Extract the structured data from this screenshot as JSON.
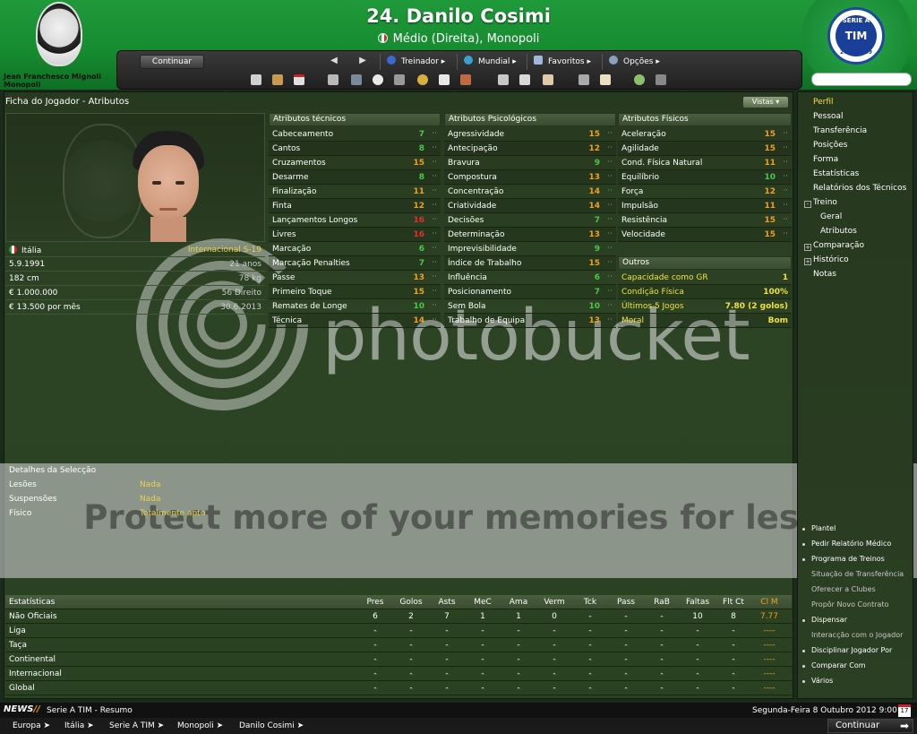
{
  "header": {
    "manager_name": "Jean Franchesco Mignoli",
    "manager_club": "Monopoli",
    "player_title": "24. Danilo Cosimi",
    "player_subtitle": "Médio (Direita), Monopoli",
    "league_badge_top": "SERIE A",
    "league_badge_main": "TIM",
    "league_badge_season": "2008-2009"
  },
  "toolbar": {
    "continue_label": "Continuar",
    "back_arrow": "◀",
    "forward_arrow": "▶",
    "menus": [
      "Treinador ▸",
      "Mundial ▸",
      "Favoritos ▸",
      "Opções ▸"
    ]
  },
  "panel": {
    "title": "Ficha do Jogador - Atributos",
    "views_label": "Vistas ▾"
  },
  "player_info": [
    {
      "label": "Itália",
      "value": "Internacional S-19",
      "flag": true
    },
    {
      "label": "5.9.1991",
      "value": "21 anos"
    },
    {
      "label": "182 cm",
      "value": "78 kg"
    },
    {
      "label": "€ 1.000.000",
      "value": "56 Direito"
    },
    {
      "label": "€ 13.500 por mês",
      "value": "30.6.2013"
    }
  ],
  "technical": {
    "title": "Atributos técnicos",
    "rows": [
      {
        "name": "Cabeceamento",
        "value": "7",
        "color": "#4ac84a"
      },
      {
        "name": "Cantos",
        "value": "8",
        "color": "#4ac84a"
      },
      {
        "name": "Cruzamentos",
        "value": "15",
        "color": "#f0a020"
      },
      {
        "name": "Desarme",
        "value": "8",
        "color": "#4ac84a"
      },
      {
        "name": "Finalização",
        "value": "11",
        "color": "#f0a020"
      },
      {
        "name": "Finta",
        "value": "12",
        "color": "#f0a020"
      },
      {
        "name": "Lançamentos Longos",
        "value": "16",
        "color": "#e03030"
      },
      {
        "name": "Livres",
        "value": "16",
        "color": "#e03030"
      },
      {
        "name": "Marcação",
        "value": "6",
        "color": "#4ac84a"
      },
      {
        "name": "Marcação Penalties",
        "value": "7",
        "color": "#4ac84a"
      },
      {
        "name": "Passe",
        "value": "13",
        "color": "#f0a020"
      },
      {
        "name": "Primeiro Toque",
        "value": "15",
        "color": "#f0a020"
      },
      {
        "name": "Remates de Longe",
        "value": "10",
        "color": "#4ac84a"
      },
      {
        "name": "Técnica",
        "value": "14",
        "color": "#f0a020"
      }
    ]
  },
  "mental": {
    "title": "Atributos Psicológicos",
    "rows": [
      {
        "name": "Agressividade",
        "value": "15",
        "color": "#f0a020"
      },
      {
        "name": "Antecipação",
        "value": "12",
        "color": "#f0a020"
      },
      {
        "name": "Bravura",
        "value": "9",
        "color": "#4ac84a"
      },
      {
        "name": "Compostura",
        "value": "13",
        "color": "#f0a020"
      },
      {
        "name": "Concentração",
        "value": "14",
        "color": "#f0a020"
      },
      {
        "name": "Criatividade",
        "value": "14",
        "color": "#f0a020"
      },
      {
        "name": "Decisões",
        "value": "7",
        "color": "#4ac84a"
      },
      {
        "name": "Determinação",
        "value": "13",
        "color": "#f0a020"
      },
      {
        "name": "Imprevisibilidade",
        "value": "9",
        "color": "#4ac84a"
      },
      {
        "name": "Índice de Trabalho",
        "value": "15",
        "color": "#f0a020"
      },
      {
        "name": "Influência",
        "value": "6",
        "color": "#4ac84a"
      },
      {
        "name": "Posicionamento",
        "value": "7",
        "color": "#4ac84a"
      },
      {
        "name": "Sem Bola",
        "value": "10",
        "color": "#4ac84a"
      },
      {
        "name": "Trabalho de Equipa",
        "value": "13",
        "color": "#f0a020"
      }
    ]
  },
  "physical": {
    "title": "Atributos Físicos",
    "rows": [
      {
        "name": "Aceleração",
        "value": "15",
        "color": "#f0a020"
      },
      {
        "name": "Agilidade",
        "value": "15",
        "color": "#f0a020"
      },
      {
        "name": "Cond. Física Natural",
        "value": "11",
        "color": "#f0a020"
      },
      {
        "name": "Equilíbrio",
        "value": "10",
        "color": "#4ac84a"
      },
      {
        "name": "Força",
        "value": "12",
        "color": "#f0a020"
      },
      {
        "name": "Impulsão",
        "value": "11",
        "color": "#f0a020"
      },
      {
        "name": "Resistência",
        "value": "15",
        "color": "#f0a020"
      },
      {
        "name": "Velocidade",
        "value": "15",
        "color": "#f0a020"
      }
    ]
  },
  "outros": {
    "title": "Outros",
    "rows": [
      {
        "name": "Capacidade como GR",
        "value": "1"
      },
      {
        "name": "Condição Física",
        "value": "100%"
      },
      {
        "name": "Últimos 5 Jogos",
        "value": "7.80 (2 golos)"
      },
      {
        "name": "Moral",
        "value": "Bom"
      }
    ]
  },
  "watermark": {
    "text": "photobucket",
    "promo": "Protect more of your memories for less!"
  },
  "selection": {
    "title": "Detalhes da Selecção",
    "rows": [
      {
        "label": "Lesões",
        "value": "Nada"
      },
      {
        "label": "Suspensões",
        "value": "Nada"
      },
      {
        "label": "Físico",
        "value": "Totalmente apto"
      }
    ]
  },
  "stats": {
    "title": "Estatísticas",
    "columns": [
      "Pres",
      "Golos",
      "Asts",
      "MeC",
      "Ama",
      "Verm",
      "Tck",
      "Pass",
      "RaB",
      "Faltas",
      "Flt Ct",
      "Cl M"
    ],
    "rows": [
      {
        "label": "Não Oficiais",
        "cells": [
          "6",
          "2",
          "7",
          "1",
          "1",
          "0",
          "-",
          "-",
          "-",
          "10",
          "8",
          "7.77"
        ]
      },
      {
        "label": "Liga",
        "cells": [
          "-",
          "-",
          "-",
          "-",
          "-",
          "-",
          "-",
          "-",
          "-",
          "-",
          "-",
          "----"
        ]
      },
      {
        "label": "Taça",
        "cells": [
          "-",
          "-",
          "-",
          "-",
          "-",
          "-",
          "-",
          "-",
          "-",
          "-",
          "-",
          "----"
        ]
      },
      {
        "label": "Continental",
        "cells": [
          "-",
          "-",
          "-",
          "-",
          "-",
          "-",
          "-",
          "-",
          "-",
          "-",
          "-",
          "----"
        ]
      },
      {
        "label": "Internacional",
        "cells": [
          "-",
          "-",
          "-",
          "-",
          "-",
          "-",
          "-",
          "-",
          "-",
          "-",
          "-",
          "----"
        ]
      },
      {
        "label": "Global",
        "cells": [
          "-",
          "-",
          "-",
          "-",
          "-",
          "-",
          "-",
          "-",
          "-",
          "-",
          "-",
          "----"
        ]
      }
    ]
  },
  "sidebar": {
    "items": [
      {
        "label": "Perfil",
        "active": true
      },
      {
        "label": "Pessoal"
      },
      {
        "label": "Transferência"
      },
      {
        "label": "Posições"
      },
      {
        "label": "Forma"
      },
      {
        "label": "Estatísticas"
      },
      {
        "label": "Relatórios dos Técnicos"
      },
      {
        "label": "Treino",
        "toggle": "-"
      },
      {
        "label": "Geral",
        "sub": true
      },
      {
        "label": "Atributos",
        "sub": true
      },
      {
        "label": "Comparação",
        "toggle": "+"
      },
      {
        "label": "Histórico",
        "toggle": "+"
      },
      {
        "label": "Notas"
      }
    ],
    "actions": [
      {
        "label": "Plantel",
        "bullet": true
      },
      {
        "label": "Pedir Relatório Médico",
        "bullet": true
      },
      {
        "label": "Programa de Treinos",
        "bullet": true
      },
      {
        "label": "Situação de Transferência"
      },
      {
        "label": "Oferecer a Clubes"
      },
      {
        "label": "Propôr Novo Contrato"
      },
      {
        "label": "Dispensar",
        "bullet": true
      },
      {
        "label": "Interacção com o Jogador"
      },
      {
        "label": "Disciplinar Jogador Por",
        "bullet": true
      },
      {
        "label": "Comparar Com",
        "bullet": true
      },
      {
        "label": "Vários",
        "bullet": true
      }
    ]
  },
  "footer": {
    "news_logo": "NEWS",
    "news_slash": "//",
    "news_text": "Serie A TIM - Resumo",
    "date": "Segunda-Feira 8 Outubro 2012 9:00",
    "calendar_day": "17",
    "breadcrumbs": [
      "Europa",
      "Itália",
      "Serie A TIM",
      "Monopoli",
      "Danilo Cosimi"
    ],
    "continue_label": "Continuar"
  }
}
